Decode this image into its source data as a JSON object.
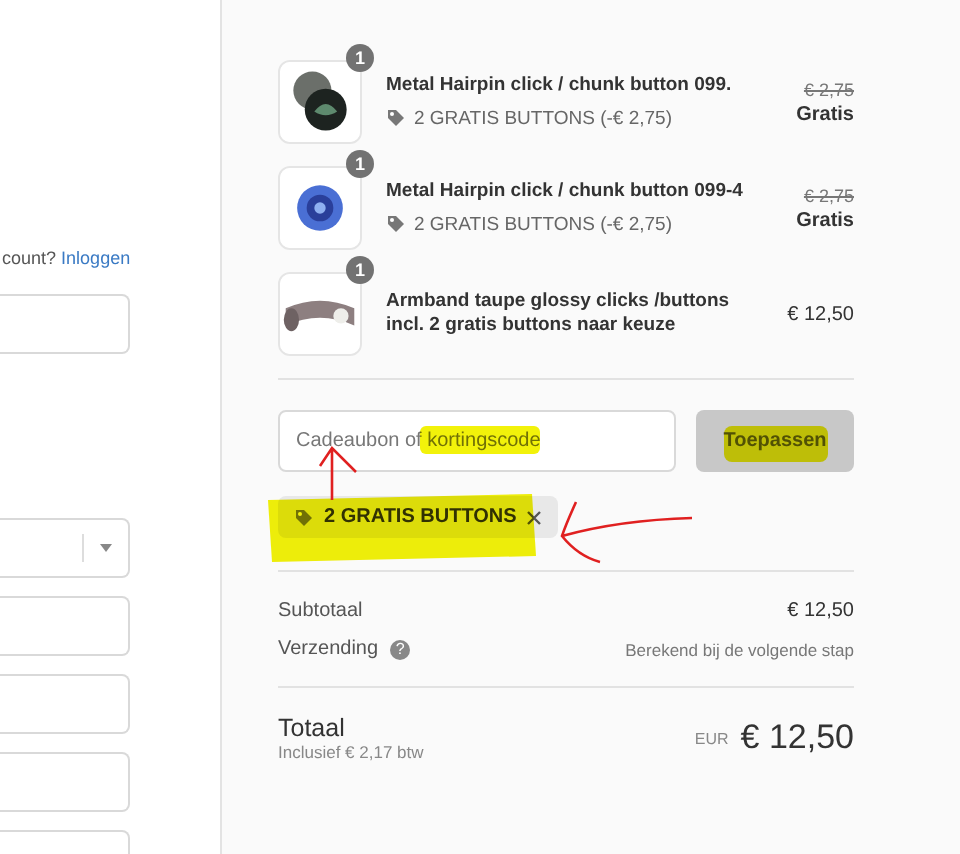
{
  "account_prompt": {
    "text": "count?",
    "link": "Inloggen"
  },
  "left_fields": [
    {
      "kind": "input"
    },
    {
      "kind": "select"
    },
    {
      "kind": "input"
    },
    {
      "kind": "input"
    },
    {
      "kind": "input"
    },
    {
      "kind": "input"
    }
  ],
  "items": [
    {
      "badge": "1",
      "name": "Metal Hairpin click / chunk button 099.",
      "discount": "2 GRATIS BUTTONS (-€ 2,75)",
      "original_price": "€ 2,75",
      "price": "Gratis"
    },
    {
      "badge": "1",
      "name": "Metal Hairpin click / chunk button 099-4",
      "discount": "2 GRATIS BUTTONS (-€ 2,75)",
      "original_price": "€ 2,75",
      "price": "Gratis"
    },
    {
      "badge": "1",
      "name": "Armband taupe glossy clicks /buttons incl. 2 gratis buttons naar keuze",
      "price": "€ 12,50"
    }
  ],
  "discount": {
    "placeholder": "Cadeaubon of kortingscode",
    "button": "Toepassen",
    "tags": [
      {
        "label": "2 GRATIS BUTTONS"
      }
    ]
  },
  "summary": [
    {
      "label": "Subtotaal",
      "value": "€ 12,50",
      "kind": "amount"
    },
    {
      "label": "Verzending",
      "value": "Berekend bij de volgende stap",
      "kind": "note",
      "help_icon": "?"
    }
  ],
  "total": {
    "label": "Totaal",
    "tax_note": "Inclusief € 2,17 btw",
    "currency": "EUR",
    "amount": "€ 12,50"
  }
}
